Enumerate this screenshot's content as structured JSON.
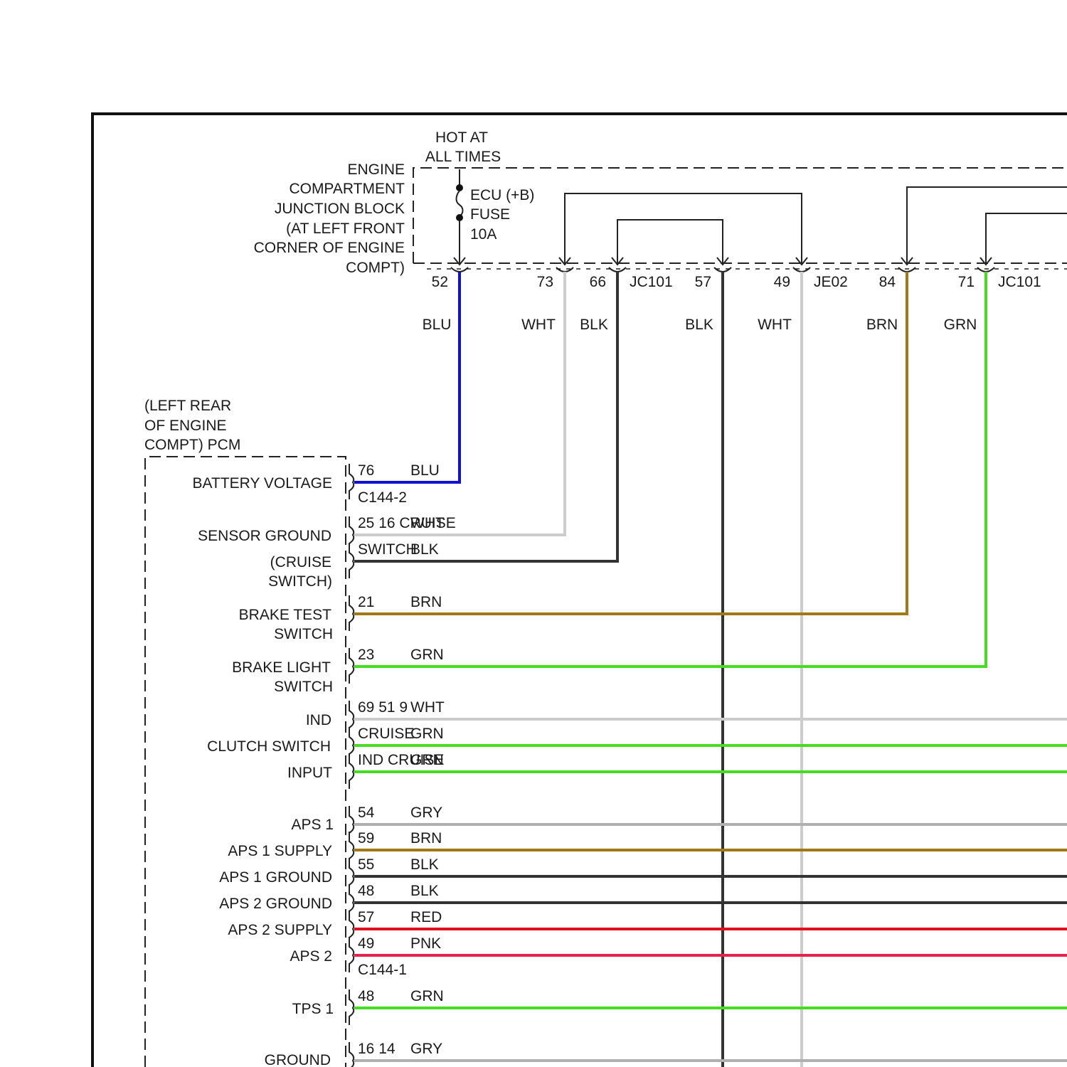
{
  "top_block": {
    "hot_label": [
      "HOT AT",
      "ALL TIMES"
    ],
    "block_label": [
      "ENGINE",
      "COMPARTMENT",
      "JUNCTION BLOCK",
      "(AT LEFT FRONT",
      "CORNER OF ENGINE",
      "COMPT)"
    ],
    "fuse_label": [
      "ECU (+B)",
      "FUSE",
      "10A"
    ],
    "pins": [
      "52",
      "73",
      "66",
      "57",
      "49",
      "84",
      "71"
    ],
    "connectors": [
      "JC101",
      "JE02",
      "JC101"
    ]
  },
  "wire_colors": {
    "BLU": "#1010d0",
    "WHT": "#cccccc",
    "BLK": "#333333",
    "BRN": "#a07818",
    "GRN": "#44dd22",
    "GRY": "#b0b0b0",
    "RED": "#e01020",
    "PNK": "#e8204a"
  },
  "top_wire_labels": [
    "BLU",
    "WHT",
    "BLK",
    "BLK",
    "WHT",
    "BRN",
    "GRN"
  ],
  "pcm": {
    "label": [
      "(LEFT REAR",
      "OF ENGINE",
      "COMPT) PCM"
    ],
    "connector_1": "C144-2",
    "connector_2": "C144-1",
    "functions": [
      [
        "BATTERY VOLTAGE"
      ],
      [
        "SENSOR GROUND"
      ],
      [
        "(CRUISE",
        "SWITCH)"
      ],
      [
        "BRAKE TEST",
        "SWITCH"
      ],
      [
        "BRAKE LIGHT",
        "SWITCH"
      ],
      [
        "IND"
      ],
      [
        "CLUTCH SWITCH"
      ],
      [
        "INPUT"
      ],
      [
        "APS 1"
      ],
      [
        "APS 1 SUPPLY"
      ],
      [
        "APS 1 GROUND"
      ],
      [
        "APS 2 GROUND"
      ],
      [
        "APS 2 SUPPLY"
      ],
      [
        "APS 2"
      ],
      [
        "TPS 1"
      ],
      [
        "GROUND"
      ]
    ],
    "pin_rows": [
      {
        "pin": "76",
        "color": "BLU"
      },
      {
        "pin": "25 16 CRUISE",
        "color": "WHT"
      },
      {
        "pin": "SWITCH",
        "color": "BLK"
      },
      {
        "pin": "21",
        "color": "BRN"
      },
      {
        "pin": "23",
        "color": "GRN"
      },
      {
        "pin": "69 51 9",
        "color": "WHT"
      },
      {
        "pin": "CRUISE",
        "color": "GRN"
      },
      {
        "pin": "IND CRUISE",
        "color": "GRN"
      },
      {
        "pin": "54",
        "color": "GRY"
      },
      {
        "pin": "59",
        "color": "BRN"
      },
      {
        "pin": "55",
        "color": "BLK"
      },
      {
        "pin": "48",
        "color": "BLK"
      },
      {
        "pin": "57",
        "color": "RED"
      },
      {
        "pin": "49",
        "color": "PNK"
      },
      {
        "pin": "48",
        "color": "GRN"
      },
      {
        "pin": "16 14",
        "color": "GRY"
      }
    ]
  }
}
